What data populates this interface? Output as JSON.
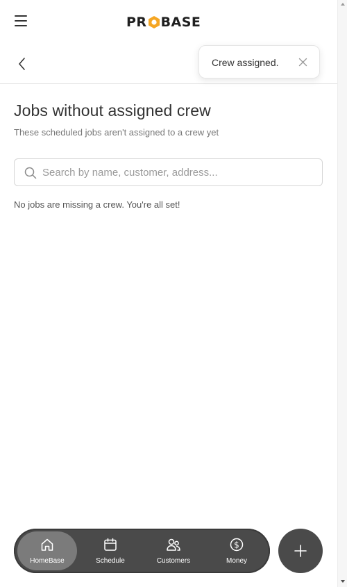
{
  "header": {
    "logo_text_left": "PR",
    "logo_text_right": "BASE",
    "logo_hex_color": "#f5a623"
  },
  "toast": {
    "message": "Crew assigned."
  },
  "main": {
    "title": "Jobs without assigned crew",
    "subtitle": "These scheduled jobs aren't assigned to a crew yet",
    "search_placeholder": "Search by name, customer, address...",
    "empty_message": "No jobs are missing a crew. You're all set!"
  },
  "bottom_nav": {
    "items": [
      {
        "label": "HomeBase",
        "icon": "home-icon",
        "active": true
      },
      {
        "label": "Schedule",
        "icon": "calendar-icon",
        "active": false
      },
      {
        "label": "Customers",
        "icon": "people-icon",
        "active": false
      },
      {
        "label": "Money",
        "icon": "dollar-icon",
        "active": false
      }
    ]
  },
  "colors": {
    "nav_background": "#4a4a4a",
    "nav_active": "#7b7b7b",
    "accent": "#f5a623"
  }
}
